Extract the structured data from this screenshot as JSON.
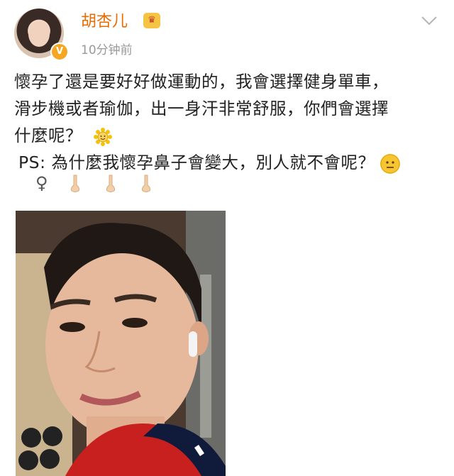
{
  "post": {
    "username": "胡杏儿",
    "time": "10分钟前",
    "verified_badge": "V",
    "crown_badge": "vip",
    "line1": "懷孕了還是要好好做運動的，我會選擇健身單車，",
    "line2": "滑步機或者瑜伽，出一身汗非常舒服，你們會選擇",
    "line3": "什麼呢？",
    "line4": "PS: 為什麼我懷孕鼻子會變大，別人就不會呢？",
    "female_symbol": "♀",
    "icons": [
      "sunflower-emoji",
      "neutral-face-emoji",
      "nose-emoji"
    ]
  },
  "colors": {
    "username": "#e86b00",
    "timestamp": "#999999",
    "text": "#222222",
    "badge": "#f5a623"
  }
}
